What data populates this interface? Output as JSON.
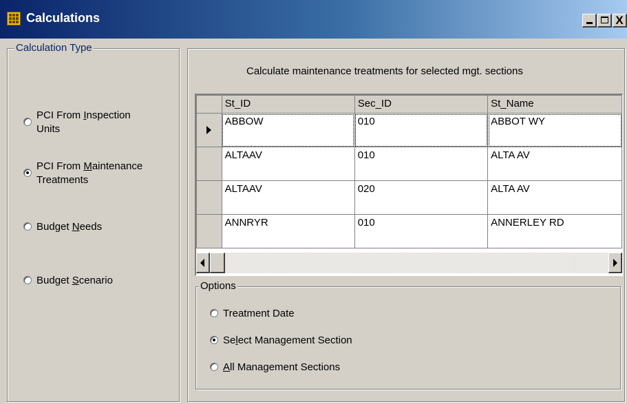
{
  "window": {
    "title": "Calculations",
    "icon": "calculator-icon",
    "minimize_icon": "minimize-icon",
    "maximize_icon": "maximize-icon",
    "close_label": "X"
  },
  "calc_type": {
    "legend": "Calculation Type",
    "options": [
      {
        "label_pre": "PCI From ",
        "mnemonic": "I",
        "label_post": "nspection",
        "line2": "Units",
        "checked": false
      },
      {
        "label_pre": "PCI From ",
        "mnemonic": "M",
        "label_post": "aintenance",
        "line2": "Treatments",
        "checked": true
      },
      {
        "label_pre": "Budget ",
        "mnemonic": "N",
        "label_post": "eeds",
        "line2": "",
        "checked": false
      },
      {
        "label_pre": "Budget ",
        "mnemonic": "S",
        "label_post": "cenario",
        "line2": "",
        "checked": false
      }
    ]
  },
  "grid": {
    "caption": "Calculate maintenance treatments for selected mgt. sections",
    "columns": [
      "St_ID",
      "Sec_ID",
      "St_Name"
    ],
    "rows": [
      {
        "st_id": "ABBOW",
        "sec_id": "010",
        "st_name": "ABBOT WY",
        "current": true
      },
      {
        "st_id": "ALTAAV",
        "sec_id": "010",
        "st_name": "ALTA AV",
        "current": false
      },
      {
        "st_id": "ALTAAV",
        "sec_id": "020",
        "st_name": "ALTA AV",
        "current": false
      },
      {
        "st_id": "ANNRYR",
        "sec_id": "010",
        "st_name": "ANNERLEY RD",
        "current": false
      }
    ]
  },
  "options": {
    "legend": "Options",
    "items": [
      {
        "label_pre": "Treatment Date",
        "mnemonic": "",
        "label_post": "",
        "checked": false
      },
      {
        "label_pre": "Se",
        "mnemonic": "l",
        "label_post": "ect Management Section",
        "checked": true
      },
      {
        "label_pre": "",
        "mnemonic": "A",
        "label_post": "ll Management Sections",
        "checked": false
      }
    ]
  }
}
